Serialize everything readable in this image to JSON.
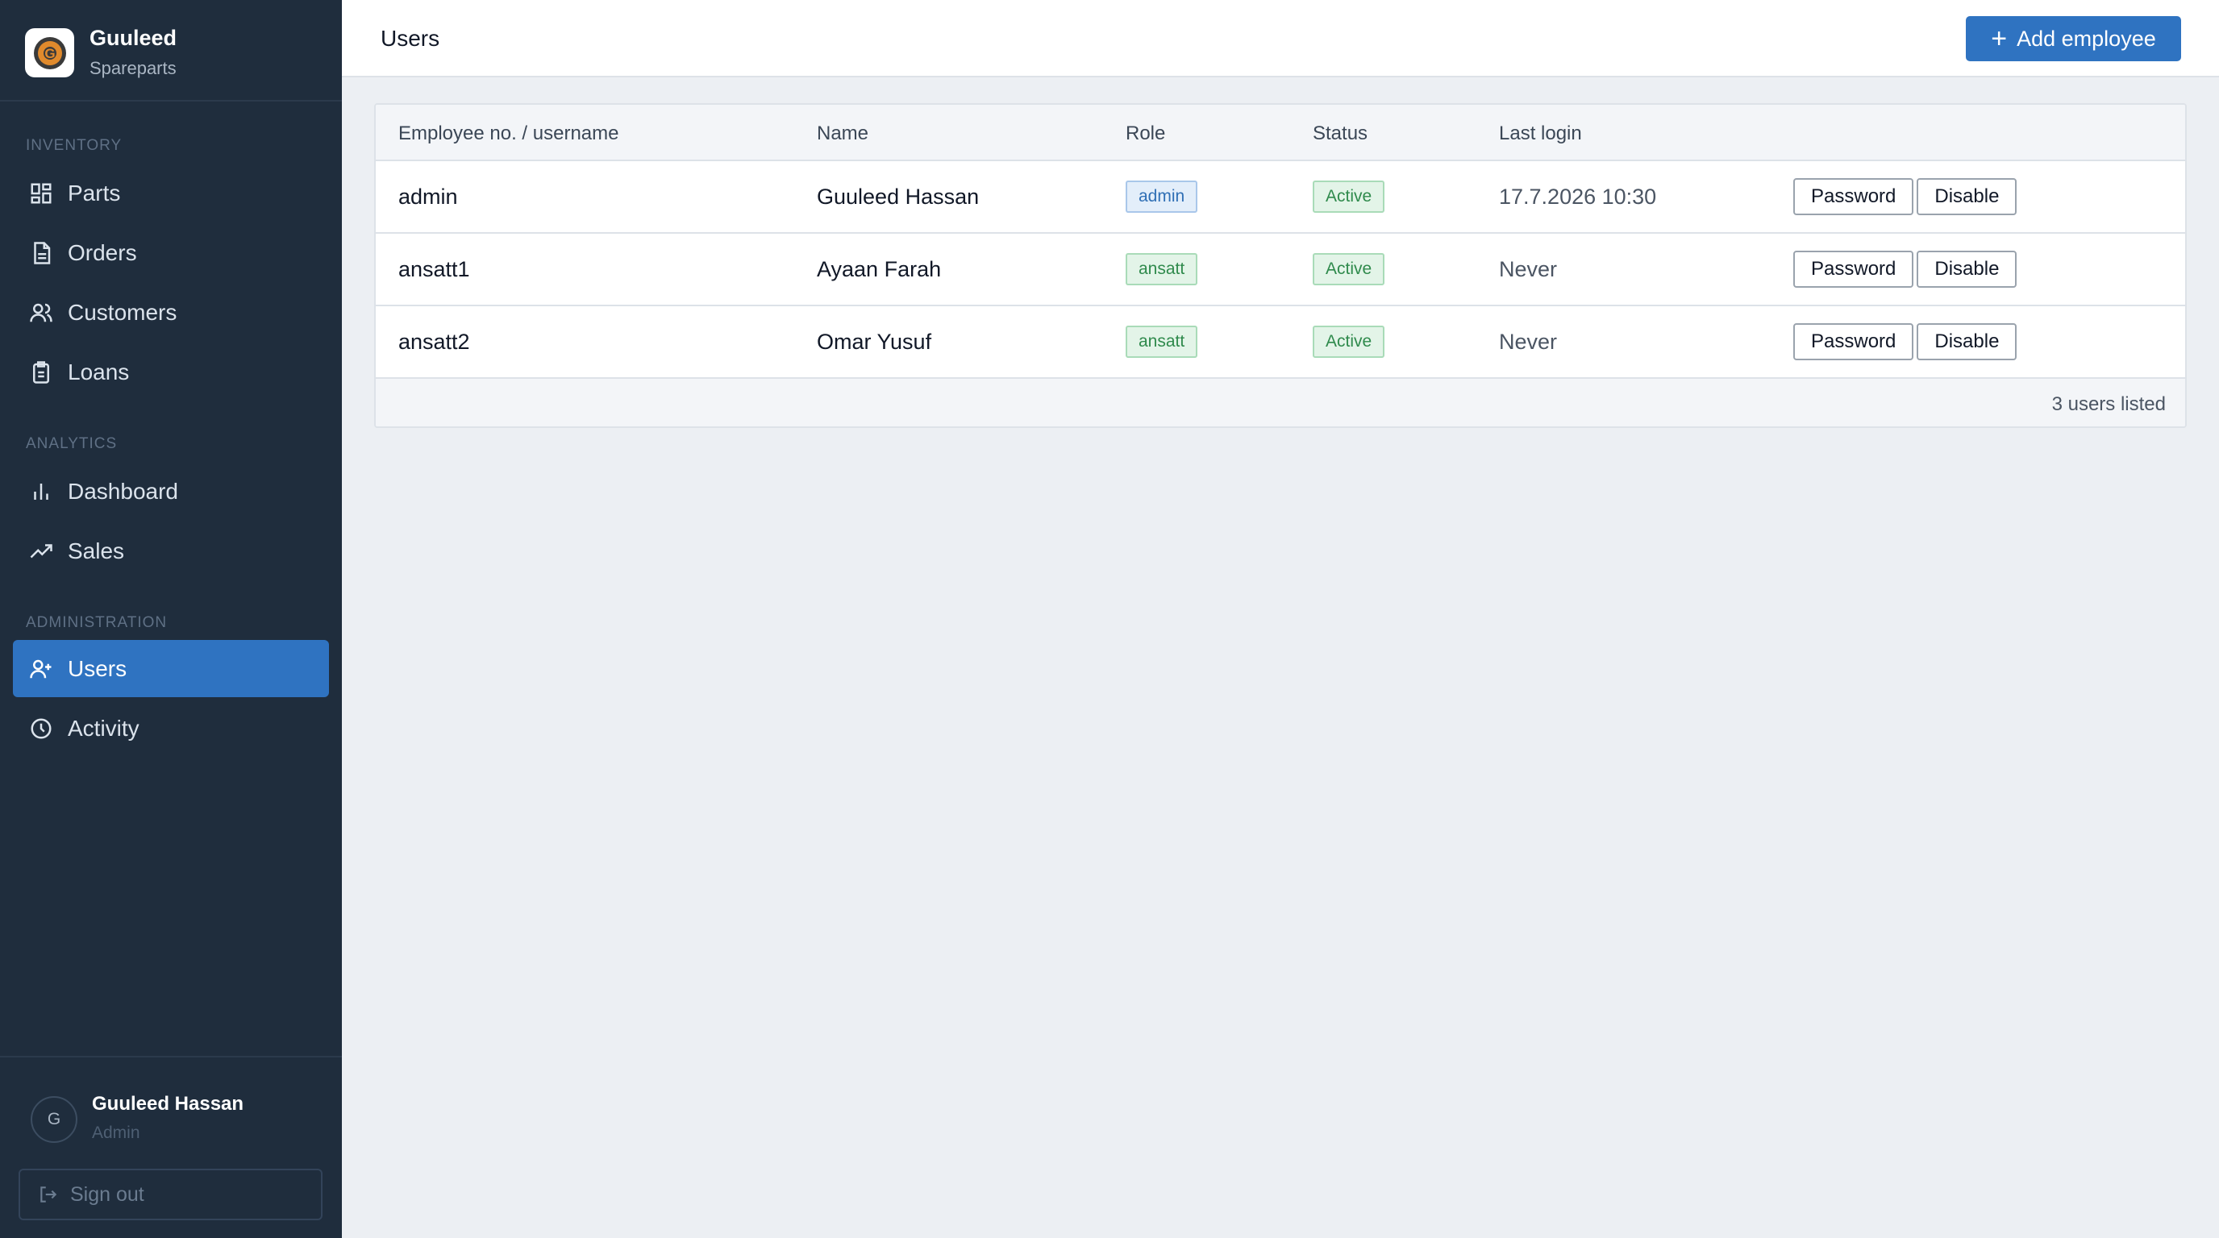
{
  "brand": {
    "name": "Guuleed",
    "subtitle": "Spareparts"
  },
  "sidebar": {
    "sections": [
      {
        "label": "INVENTORY",
        "items": [
          "Parts",
          "Orders",
          "Customers",
          "Loans"
        ]
      },
      {
        "label": "ANALYTICS",
        "items": [
          "Dashboard",
          "Sales"
        ]
      },
      {
        "label": "ADMINISTRATION",
        "items": [
          "Users",
          "Activity"
        ]
      }
    ],
    "active_item": "Users"
  },
  "current_user": {
    "initial": "G",
    "name": "Guuleed Hassan",
    "role": "Admin"
  },
  "signout_label": "Sign out",
  "header": {
    "title": "Users",
    "add_button": "Add employee"
  },
  "table": {
    "columns": [
      "Employee no. / username",
      "Name",
      "Role",
      "Status",
      "Last login"
    ],
    "rows": [
      {
        "username": "admin",
        "name": "Guuleed Hassan",
        "role": "admin",
        "status": "Active",
        "last_login": "17.7.2026 10:30",
        "actions": [
          "Password",
          "Disable"
        ]
      },
      {
        "username": "ansatt1",
        "name": "Ayaan Farah",
        "role": "ansatt",
        "status": "Active",
        "last_login": "Never",
        "actions": [
          "Password",
          "Disable"
        ]
      },
      {
        "username": "ansatt2",
        "name": "Omar Yusuf",
        "role": "ansatt",
        "status": "Active",
        "last_login": "Never",
        "actions": [
          "Password",
          "Disable"
        ]
      }
    ],
    "footer": "3 users listed"
  },
  "colors": {
    "sidebar_bg": "#1f2d3d",
    "accent": "#2f73c1",
    "success": "#2f8a4c"
  }
}
